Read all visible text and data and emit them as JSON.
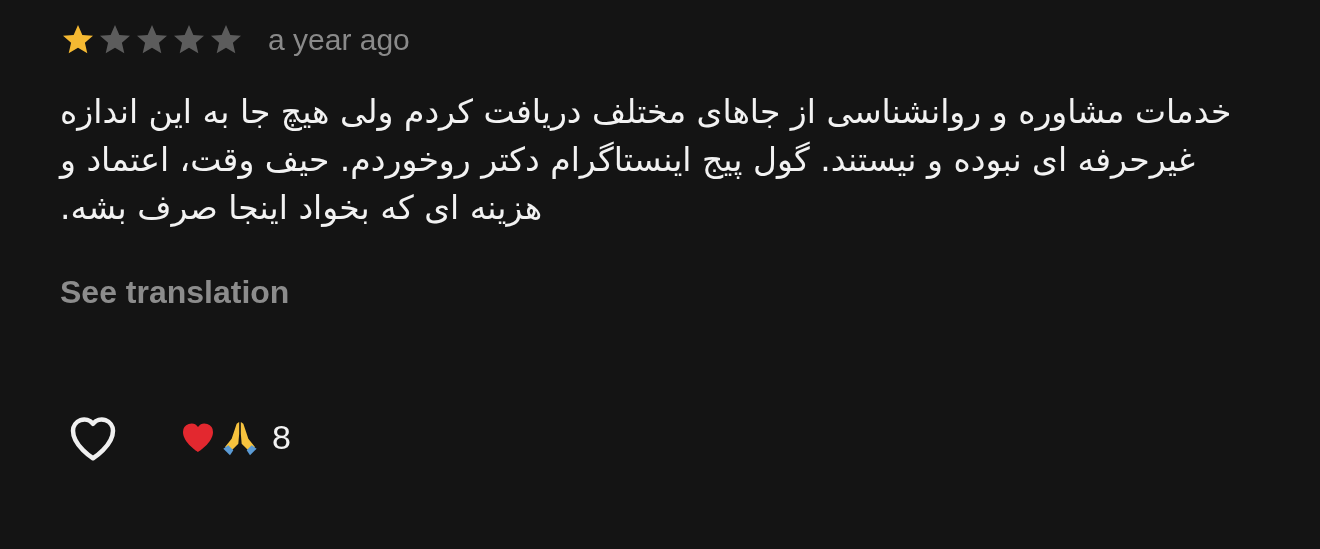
{
  "review": {
    "stars": 1,
    "time": "a year ago",
    "text": "خدمات مشاوره و روانشناسی از جاهای مختلف دریافت کردم ولی هیچ جا به این اندازه غیرحرفه ای نبوده و نیستند. گول پیج اینستاگرام دکتر روخوردم. حیف وقت، اعتماد و هزینه ای که بخواد اینجا صرف بشه.",
    "translate_link": "See translation",
    "liked": false,
    "reaction_count": "8"
  }
}
